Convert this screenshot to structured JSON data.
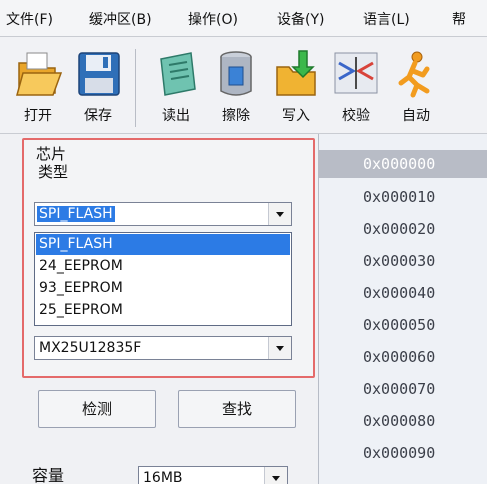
{
  "menu": {
    "items": [
      "文件(F)",
      "缓冲区(B)",
      "操作(O)",
      "设备(Y)",
      "语言(L)",
      "帮"
    ]
  },
  "toolbar": {
    "buttons": [
      {
        "label": "打开",
        "icon": "folder-open-icon"
      },
      {
        "label": "保存",
        "icon": "floppy-disk-icon"
      },
      {
        "label": "读出",
        "icon": "read-chip-icon"
      },
      {
        "label": "擦除",
        "icon": "erase-chip-icon"
      },
      {
        "label": "写入",
        "icon": "write-folder-icon"
      },
      {
        "label": "校验",
        "icon": "verify-icon"
      },
      {
        "label": "自动",
        "icon": "auto-runner-icon"
      }
    ]
  },
  "chip": {
    "group_title": "芯片",
    "type_label": "类型",
    "type_value": "SPI_FLASH",
    "type_options": [
      "SPI_FLASH",
      "24_EEPROM",
      "93_EEPROM",
      "25_EEPROM"
    ],
    "model_value": "MX25U12835F"
  },
  "actions": {
    "detect": "检测",
    "search": "查找"
  },
  "capacity": {
    "label": "容量",
    "value": "16MB"
  },
  "addresses": [
    "0x000000",
    "0x000010",
    "0x000020",
    "0x000030",
    "0x000040",
    "0x000050",
    "0x000060",
    "0x000070",
    "0x000080",
    "0x000090"
  ],
  "colors": {
    "highlight_border": "#e46a6a",
    "selection": "#2c7be5",
    "address_header": "#b8bcc6"
  }
}
